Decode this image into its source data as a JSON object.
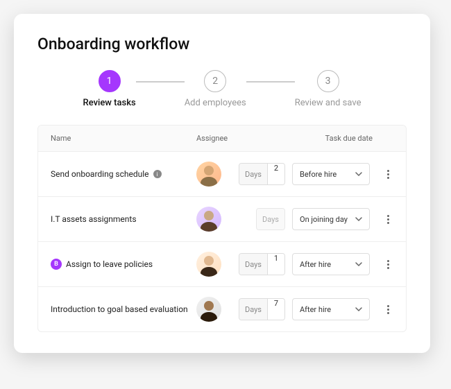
{
  "title": "Onboarding workflow",
  "stepper": {
    "steps": [
      {
        "num": "1",
        "label": "Review tasks",
        "active": true
      },
      {
        "num": "2",
        "label": "Add employees",
        "active": false
      },
      {
        "num": "3",
        "label": "Review and save",
        "active": false
      }
    ]
  },
  "table": {
    "headers": {
      "name": "Name",
      "assignee": "Assignee",
      "due": "Task due date"
    },
    "days_label": "Days",
    "rows": [
      {
        "name": "Send onboarding schedule",
        "has_info": true,
        "has_badge": false,
        "days": "2",
        "days_disabled": false,
        "timing": "Before hire",
        "avatar_variant": "v1"
      },
      {
        "name": "I.T assets assignments",
        "has_info": false,
        "has_badge": false,
        "days": "",
        "days_disabled": true,
        "timing": "On joining day",
        "avatar_variant": "v2"
      },
      {
        "name": "Assign to leave policies",
        "has_info": false,
        "has_badge": true,
        "badge_text": "B",
        "days": "1",
        "days_disabled": false,
        "timing": "After hire",
        "avatar_variant": "v3"
      },
      {
        "name": "Introduction to goal based evaluation",
        "has_info": false,
        "has_badge": false,
        "days": "7",
        "days_disabled": false,
        "timing": "After hire",
        "avatar_variant": "v4"
      }
    ]
  }
}
